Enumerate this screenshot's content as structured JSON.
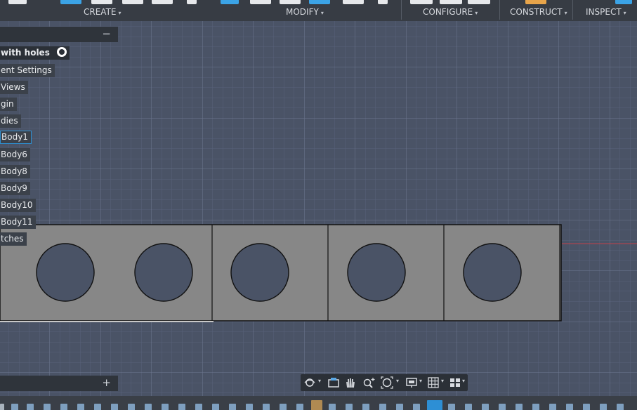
{
  "toolbar": {
    "groups": [
      {
        "label": "CREATE"
      },
      {
        "label": "MODIFY"
      },
      {
        "label": "CONFIGURE"
      },
      {
        "label": "CONSTRUCT"
      },
      {
        "label": "INSPECT"
      }
    ],
    "caret": "▾"
  },
  "browser": {
    "collapse_icon": "−",
    "items": [
      {
        "label": "with holes",
        "root": true
      },
      {
        "label": "ent Settings"
      },
      {
        "label": "Views"
      },
      {
        "label": "gin"
      },
      {
        "label": "dies"
      },
      {
        "label": "Body1",
        "selected": true
      },
      {
        "label": "Body6"
      },
      {
        "label": "Body8"
      },
      {
        "label": "Body9"
      },
      {
        "label": "Body10"
      },
      {
        "label": "Body11"
      },
      {
        "label": "tches"
      }
    ]
  },
  "comments": {
    "add_icon": "+"
  },
  "navbar": {
    "tools": [
      "orbit-icon",
      "look-at-icon",
      "pan-hand-icon",
      "zoom-icon",
      "fit-icon",
      "display-settings-icon",
      "grid-icon",
      "viewports-icon"
    ]
  },
  "colors": {
    "viewport_bg": "#4a5366",
    "body_fill": "#878787",
    "accent": "#2e8fd1",
    "x_axis": "#c0404a"
  }
}
